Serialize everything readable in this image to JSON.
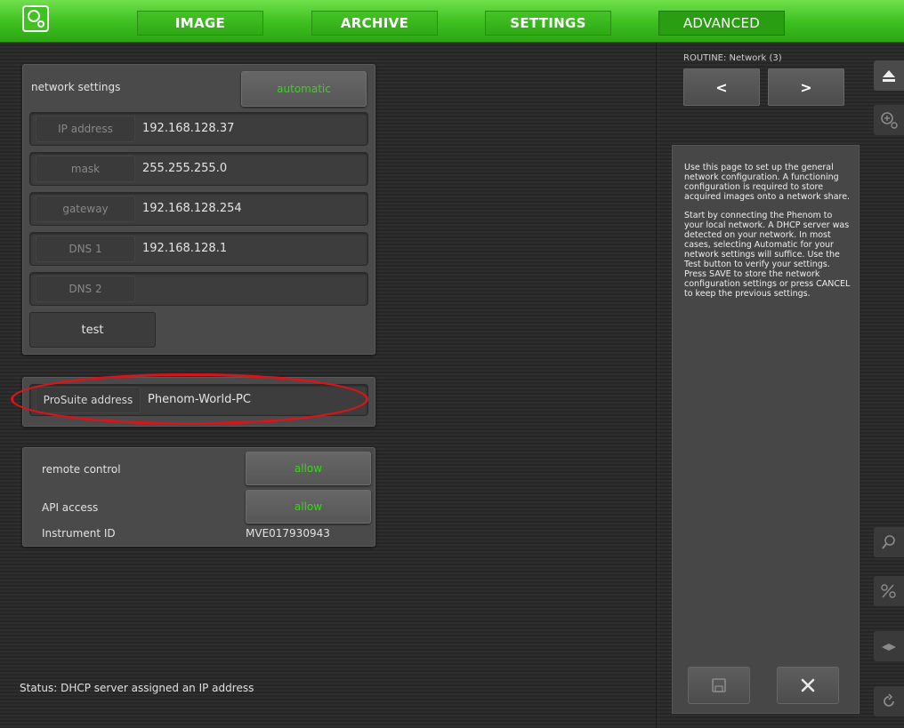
{
  "nav": {
    "tabs": [
      "IMAGE",
      "ARCHIVE",
      "SETTINGS",
      "ADVANCED"
    ],
    "active_tab": "ADVANCED"
  },
  "network": {
    "title": "network settings",
    "mode_button": "automatic",
    "fields": [
      {
        "label": "IP address",
        "value": "192.168.128.37"
      },
      {
        "label": "mask",
        "value": "255.255.255.0"
      },
      {
        "label": "gateway",
        "value": "192.168.128.254"
      },
      {
        "label": "DNS 1",
        "value": "192.168.128.1"
      },
      {
        "label": "DNS 2",
        "value": ""
      }
    ],
    "test_button": "test"
  },
  "prosuite": {
    "label": "ProSuite address",
    "value": "Phenom-World-PC"
  },
  "access": {
    "remote_control_label": "remote control",
    "remote_control_button": "allow",
    "api_access_label": "API access",
    "api_access_button": "allow",
    "instrument_id_label": "Instrument ID",
    "instrument_id_value": "MVE017930943"
  },
  "routine": {
    "title": "ROUTINE: Network (3)",
    "prev": "<",
    "next": ">"
  },
  "help": {
    "paragraph1": "Use this page to set up the general network configuration. A functioning configuration is required to store acquired images onto a network share.",
    "paragraph2": "Start by connecting the Phenom to your local network. A DHCP server was detected on your network. In most cases, selecting Automatic for your network settings will suffice. Use the Test button to verify your settings. Press SAVE to store the network configuration settings or press CANCEL to keep the previous settings."
  },
  "status": "Status: DHCP server assigned an IP address",
  "colors": {
    "accent_green": "#3bd21e",
    "highlight_red": "#d8141a"
  },
  "icons": {
    "logo": "phenom-logo-icon",
    "eject": "eject-icon",
    "zoom": "zoom-in-icon",
    "search": "search-icon",
    "save": "save-icon",
    "cancel": "close-icon"
  }
}
